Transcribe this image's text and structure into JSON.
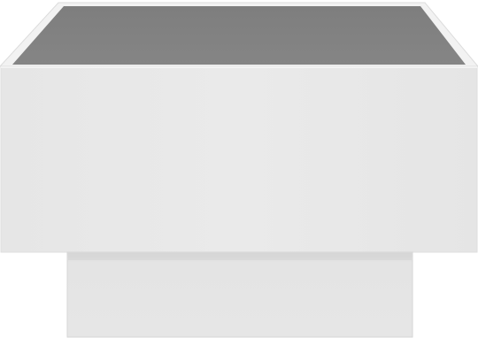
{
  "product": {
    "kind": "coffee-table",
    "colors": {
      "body": "#e8e8e8",
      "body_shade": "#e3e3e3",
      "glass_top": "#7e7e7e",
      "glass_top_dark": "#6f6f6f",
      "rim": "#f2f2f2",
      "plinth": "#e2e2e2",
      "plinth_top_shade": "#d9d9d9",
      "background": "#ffffff"
    }
  }
}
